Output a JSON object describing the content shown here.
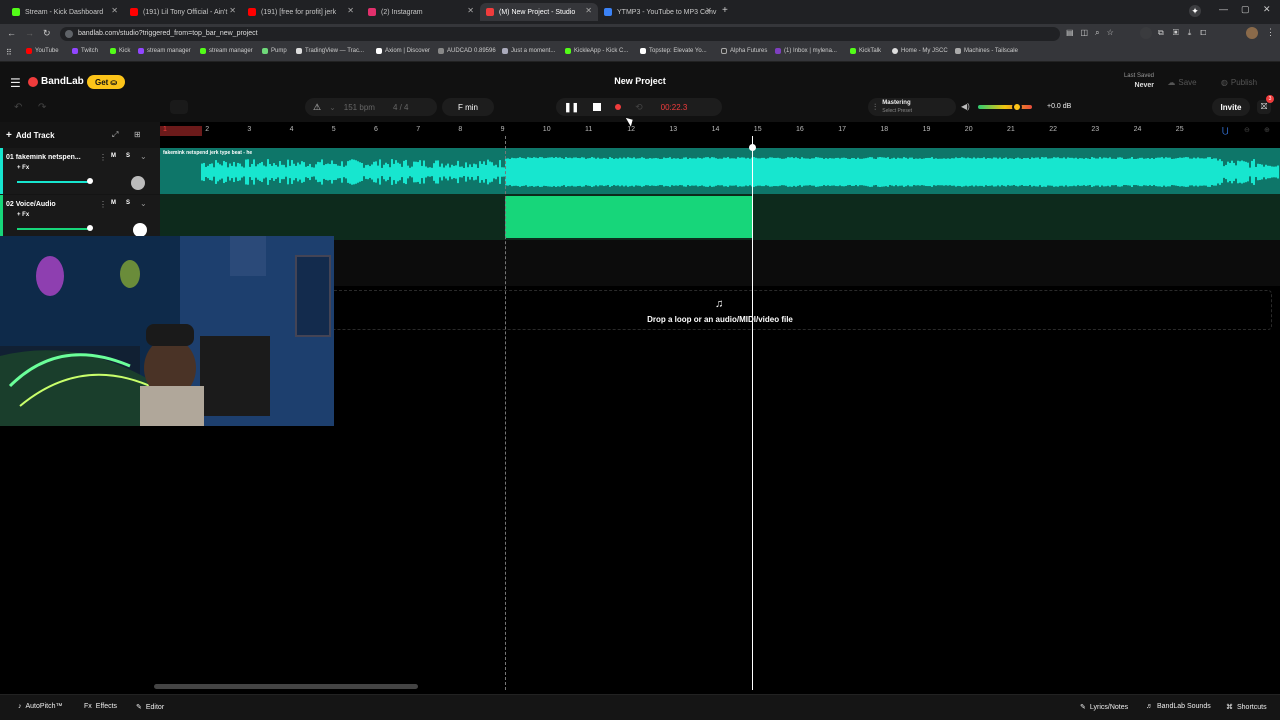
{
  "browser": {
    "tabs": [
      {
        "label": "Stream - Kick Dashboard",
        "color": "#53fc18"
      },
      {
        "label": "(191) Lil Tony Official - Ain't",
        "color": "#ff0000"
      },
      {
        "label": "(191) [free for profit] jerk",
        "color": "#ff0000"
      },
      {
        "label": "(2) Instagram",
        "color": "#e1306c"
      },
      {
        "label": "(M) New Project - Studio",
        "color": "#f03c3c"
      },
      {
        "label": "YTMP3 - YouTube to MP3 Conv",
        "color": "#3b82f6"
      }
    ],
    "url": "bandlab.com/studio?triggered_from=top_bar_new_project",
    "bookmarks": [
      "YouTube",
      "Twitch",
      "Kick",
      "stream manager",
      "stream manager",
      "Pump",
      "TradingView — Trac...",
      "Axiom | Discover",
      "AUDCAD 0.89596",
      "Just a moment...",
      "KickleApp - Kick C...",
      "Topstep: Elevate Yo...",
      "Alpha Futures",
      "(1) Inbox | mylena...",
      "KickTalk",
      "Home - My JSCC",
      "Machines - Tailscale"
    ]
  },
  "header": {
    "brand": "BandLab",
    "get_label": "Get",
    "project_title": "New Project",
    "last_saved_label": "Last Saved",
    "last_saved_value": "Never",
    "save_label": "Save",
    "publish_label": "Publish",
    "invite_label": "Invite",
    "notif_count": "3"
  },
  "transport": {
    "bpm": "151",
    "bpm_unit": "bpm",
    "time_sig": "4 / 4",
    "key": "F min",
    "time": "00:22.3",
    "mastering_label": "Mastering",
    "mastering_sub": "Select Preset",
    "volume_db": "+0.0 dB",
    "volume_level": 0.72
  },
  "tracks": {
    "add_track_label": "Add Track",
    "items": [
      {
        "name": "01  fakemink  netspen...",
        "m": "M",
        "s": "S",
        "fx": "+ Fx",
        "color": "#17e6cf",
        "region_label": "fakemink  netspend  jerk type beat - he"
      },
      {
        "name": "02  Voice/Audio",
        "m": "M",
        "s": "S",
        "fx": "+ Fx",
        "color": "#17d67a"
      }
    ]
  },
  "ruler": {
    "bars": [
      "1",
      "2",
      "3",
      "4",
      "5",
      "6",
      "7",
      "8",
      "9",
      "10",
      "11",
      "12",
      "13",
      "14",
      "15",
      "16",
      "17",
      "18",
      "19",
      "20",
      "21",
      "22",
      "23",
      "24",
      "25"
    ]
  },
  "drop": {
    "text": "Drop a loop or an audio/MIDI/video file"
  },
  "footer": {
    "autopitch": "AutoPitch™",
    "effects": "Effects",
    "editor": "Editor",
    "lyrics": "Lyrics/Notes",
    "sounds": "BandLab Sounds",
    "shortcuts": "Shortcuts"
  },
  "colors": {
    "accent": "#f03c3c",
    "region_cyan": "#17e6cf",
    "region_green": "#17d67a",
    "get_yellow": "#fcc419"
  }
}
